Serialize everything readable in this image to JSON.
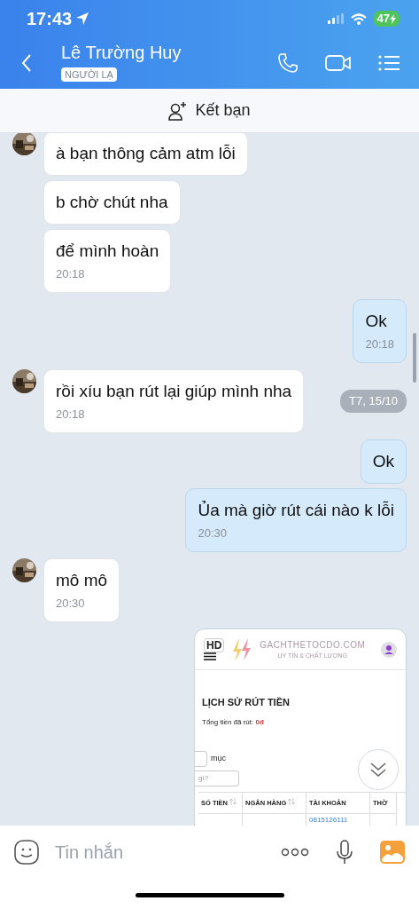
{
  "status_bar": {
    "time": "17:43",
    "battery": "47"
  },
  "header": {
    "name": "Lê Trường Huy",
    "tag": "NGƯỜI LẠ"
  },
  "add_friend": {
    "label": "Kết bạn"
  },
  "messages": [
    {
      "kind": "text",
      "outgoing": false,
      "avatar": true,
      "text": "à bạn thông cảm atm lỗi"
    },
    {
      "kind": "text",
      "outgoing": false,
      "avatar": false,
      "text": "b chờ chút nha"
    },
    {
      "kind": "text",
      "outgoing": false,
      "avatar": false,
      "text": "để mình hoàn",
      "time": "20:18"
    },
    {
      "kind": "text",
      "outgoing": true,
      "avatar": false,
      "text": "Ok",
      "time": "20:18"
    },
    {
      "kind": "text",
      "outgoing": false,
      "avatar": true,
      "text": "rồi xíu bạn rút lại giúp mình nha",
      "time": "20:18",
      "date_chip": "T7, 15/10"
    },
    {
      "kind": "text",
      "outgoing": true,
      "avatar": false,
      "text": "Ok"
    },
    {
      "kind": "text",
      "outgoing": true,
      "avatar": false,
      "text": "Ủa mà giờ rút cái nào k lỗi",
      "time": "20:30"
    },
    {
      "kind": "text",
      "outgoing": false,
      "avatar": true,
      "text": "mô mô",
      "time": "20:30"
    },
    {
      "outgoing": true,
      "avatar": false,
      "shot": {
        "badge": "HD",
        "site": "GACHTHETOCDO.COM",
        "tagline": "UY TÍN & CHẤT LƯỢNG",
        "title": "LỊCH SỬ RÚT TIỀN",
        "total_label": "Tổng tiền đã rút:",
        "total_value": "0đ",
        "entries_label": "mục",
        "search_placeholder": "gì?",
        "columns": [
          "SỐ TIỀN",
          "NGÂN HÀNG",
          "TÀI KHOẢN",
          "THỜ"
        ],
        "visible_row": {
          "account": "0815126111"
        }
      }
    }
  ],
  "input": {
    "placeholder": "Tin nhắn"
  }
}
